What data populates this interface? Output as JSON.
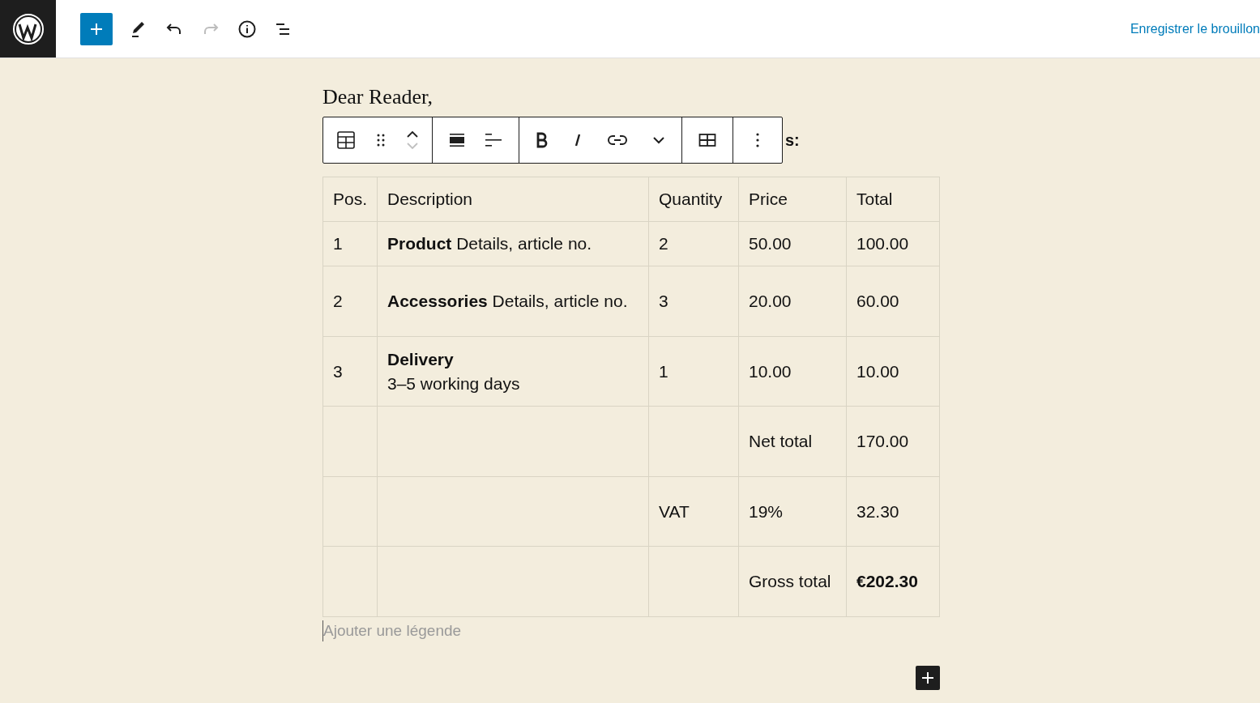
{
  "top_bar": {
    "tools": [
      {
        "kind": "add",
        "disabled": false
      },
      {
        "kind": "edit",
        "disabled": false
      },
      {
        "kind": "undo",
        "disabled": false
      },
      {
        "kind": "redo",
        "disabled": true
      },
      {
        "kind": "info",
        "disabled": false
      },
      {
        "kind": "outline",
        "disabled": false
      }
    ],
    "save_draft": "Enregistrer le brouillon"
  },
  "greeting": "Dear Reader,",
  "hidden_paragraph_tail": "s:",
  "block_toolbar": {
    "move_up_disabled": false,
    "move_down_disabled": true
  },
  "table": {
    "columns": [
      "Pos.",
      "Description",
      "Quantity",
      "Price",
      "Total"
    ],
    "rows": [
      {
        "cells": [
          {
            "text": "1"
          },
          {
            "text": "**Product** Details, article no."
          },
          {
            "text": "2"
          },
          {
            "text": "50.00"
          },
          {
            "text": "100.00"
          }
        ]
      },
      {
        "cells": [
          {
            "text": "2"
          },
          {
            "text": "**Accessories** Details, article no."
          },
          {
            "text": "3"
          },
          {
            "text": "20.00"
          },
          {
            "text": "60.00"
          }
        ]
      },
      {
        "cells": [
          {
            "text": "3"
          },
          {
            "text": "**Delivery**\n3–5 working days"
          },
          {
            "text": "1"
          },
          {
            "text": "10.00"
          },
          {
            "text": "10.00"
          }
        ]
      },
      {
        "cells": [
          {
            "text": ""
          },
          {
            "text": ""
          },
          {
            "text": ""
          },
          {
            "text": "Net total"
          },
          {
            "text": "170.00"
          }
        ]
      },
      {
        "cells": [
          {
            "text": ""
          },
          {
            "text": ""
          },
          {
            "text": "VAT"
          },
          {
            "text": "19%"
          },
          {
            "text": "32.30"
          }
        ]
      },
      {
        "cells": [
          {
            "text": ""
          },
          {
            "text": ""
          },
          {
            "text": ""
          },
          {
            "text": "Gross total"
          },
          {
            "text": "€202.30",
            "bold": true
          }
        ]
      }
    ],
    "caption_placeholder": "Ajouter une légende"
  }
}
